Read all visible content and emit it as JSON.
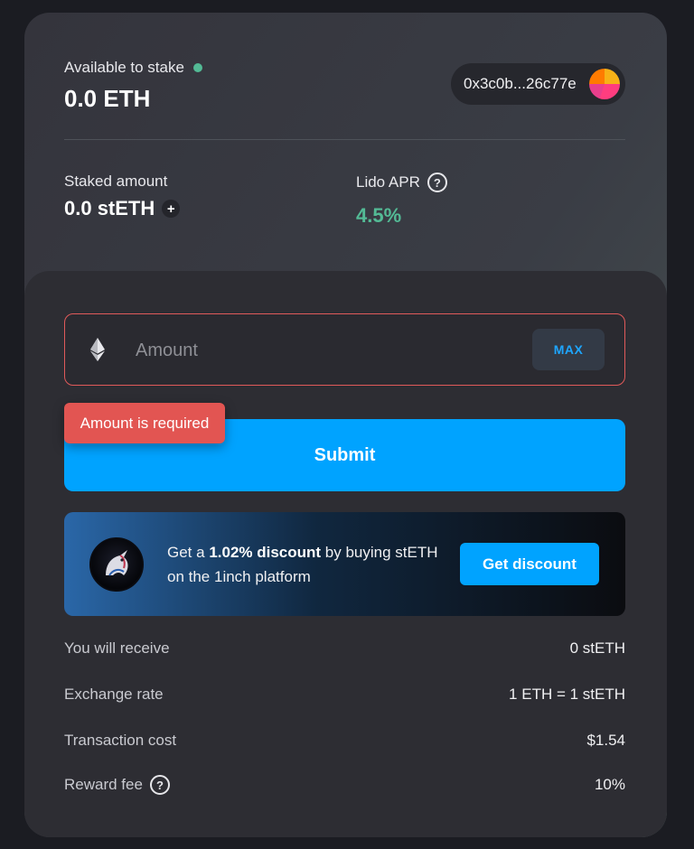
{
  "header": {
    "available_label": "Available to stake",
    "available_value": "0.0 ETH",
    "wallet_address": "0x3c0b...26c77e",
    "staked_label": "Staked amount",
    "staked_value": "0.0 stETH",
    "apr_label": "Lido APR",
    "apr_value": "4.5%"
  },
  "form": {
    "amount_placeholder": "Amount",
    "max_label": "MAX",
    "error_text": "Amount is required",
    "submit_label": "Submit"
  },
  "promo": {
    "text_prefix": "Get a ",
    "text_bold": "1.02% discount",
    "text_suffix": " by buying stETH on the 1inch platform",
    "button_label": "Get discount"
  },
  "info": [
    {
      "label": "You will receive",
      "value": "0 stETH"
    },
    {
      "label": "Exchange rate",
      "value": "1 ETH = 1 stETH"
    },
    {
      "label": "Transaction cost",
      "value": "$1.54"
    },
    {
      "label": "Reward fee",
      "value": "10%"
    }
  ],
  "colors": {
    "accent": "#00a3ff",
    "success": "#53ba95",
    "error": "#e25552"
  }
}
